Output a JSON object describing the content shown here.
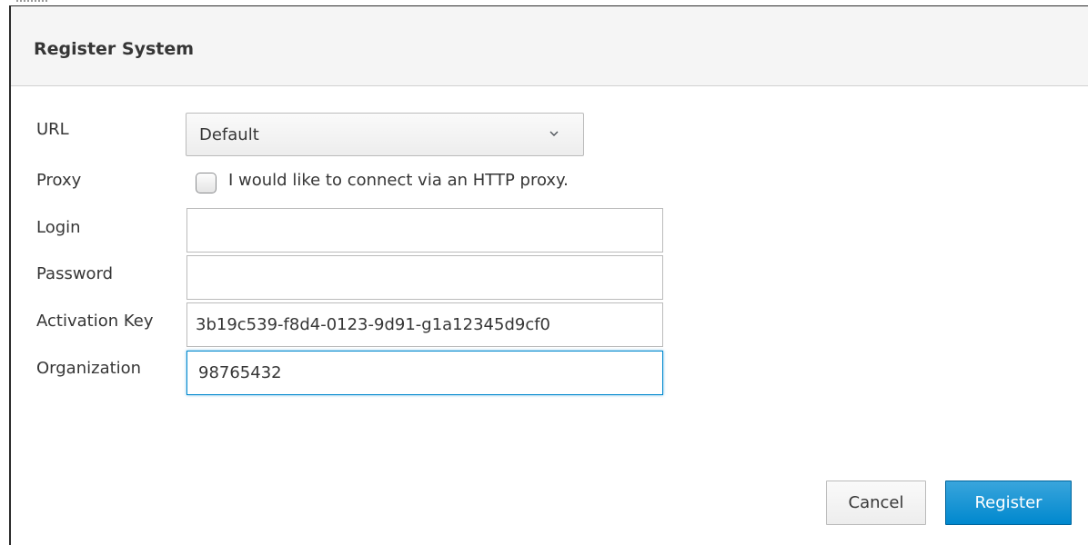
{
  "dialog": {
    "title": "Register System"
  },
  "form": {
    "url": {
      "label": "URL",
      "selected": "Default"
    },
    "proxy": {
      "label": "Proxy",
      "checkbox_label": "I would like to connect via an HTTP proxy.",
      "checked": false
    },
    "login": {
      "label": "Login",
      "value": ""
    },
    "password": {
      "label": "Password",
      "value": ""
    },
    "activation_key": {
      "label": "Activation Key",
      "value": "3b19c539-f8d4-0123-9d91-g1a12345d9cf0"
    },
    "organization": {
      "label": "Organization",
      "value": "98765432"
    }
  },
  "buttons": {
    "cancel": "Cancel",
    "register": "Register"
  },
  "colors": {
    "primary": "#0088ce",
    "header_bg": "#f5f5f5",
    "text": "#363636"
  },
  "icons": {
    "dropdown": "chevron-down-icon"
  }
}
